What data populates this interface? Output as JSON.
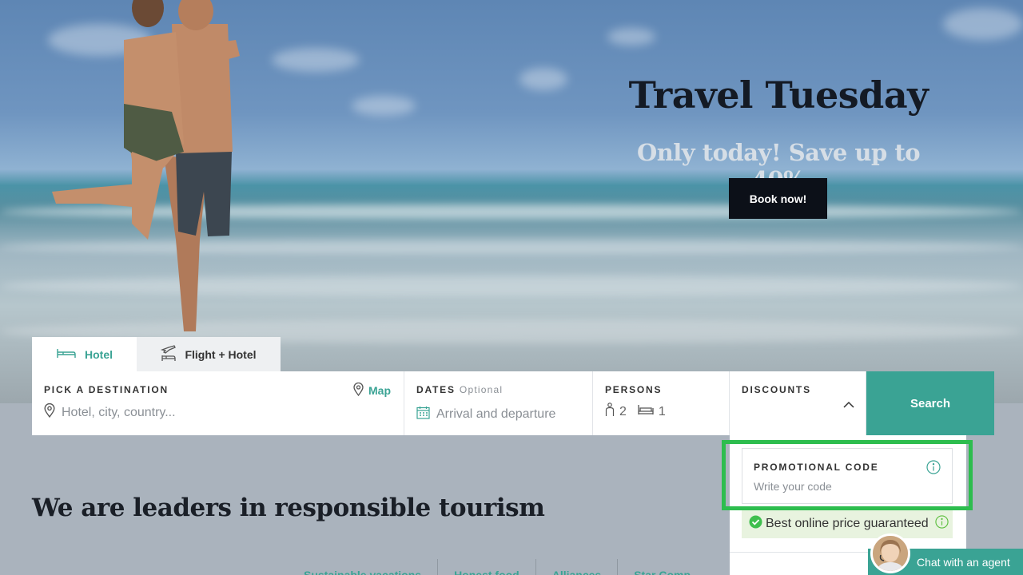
{
  "hero": {
    "title": "Travel Tuesday",
    "subtitle": "Only today! Save up to 40%",
    "cta_label": "Book now!"
  },
  "tabs": [
    {
      "label": "Hotel",
      "icon": "bed-icon",
      "active": true
    },
    {
      "label": "Flight + Hotel",
      "icon": "plane-bed-icon",
      "active": false
    }
  ],
  "search": {
    "destination_label": "PICK A DESTINATION",
    "destination_placeholder": "Hotel, city, country...",
    "map_label": "Map",
    "dates_label": "DATES",
    "dates_optional": "Optional",
    "dates_placeholder": "Arrival and departure",
    "persons_label": "PERSONS",
    "persons_count": "2",
    "rooms_count": "1",
    "discounts_label": "DISCOUNTS",
    "search_label": "Search"
  },
  "discounts_panel": {
    "promo_label": "PROMOTIONAL CODE",
    "promo_placeholder": "Write your code",
    "guarantee_text": "Best online price guaranteed"
  },
  "section": {
    "title": "We are leaders in responsible tourism",
    "links": [
      "Sustainable vacations",
      "Honest food",
      "Alliances",
      "Star Comp"
    ]
  },
  "chat": {
    "label": "Chat with an agent"
  },
  "colors": {
    "accent": "#3aa394",
    "highlight": "#2dbd4e",
    "dark": "#0c1018"
  }
}
